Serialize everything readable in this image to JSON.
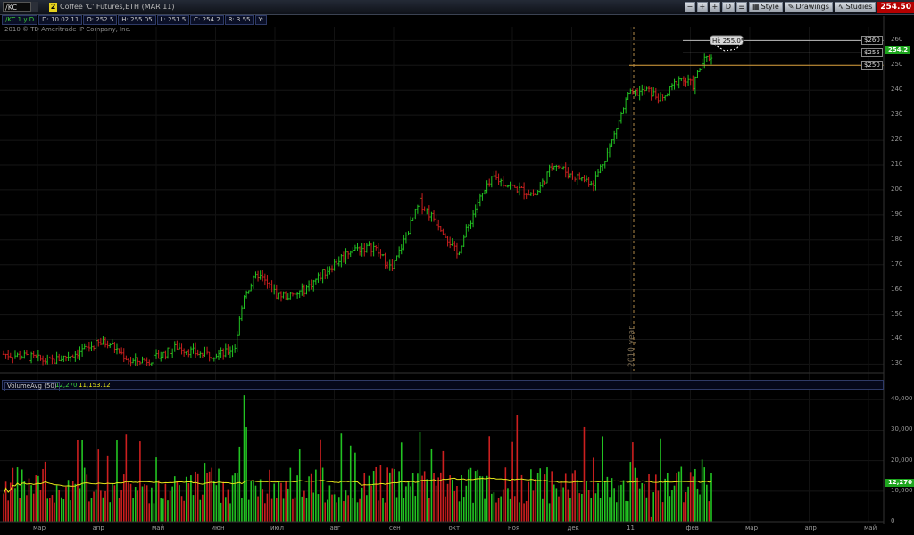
{
  "toolbar": {
    "symbol": "/KC",
    "link_number": "2",
    "description": "Coffee 'C' Futures,ETH (MAR 11)",
    "style_label": "Style",
    "drawings_label": "Drawings",
    "studies_label": "Studies",
    "d_label": "D",
    "last_price": "254.50"
  },
  "info": {
    "symbol_period": "/KC 1 y D",
    "date": "D: 10.02.11",
    "open": "O: 252.5",
    "high": "H: 255.05",
    "low": "L: 251.5",
    "close": "C: 254.2",
    "range": "R: 3.55",
    "y": "Y:"
  },
  "copyright": "2010 © TD Ameritrade IP Company, Inc.",
  "price_axis": {
    "ticks": [
      "260",
      "250",
      "240",
      "230",
      "220",
      "210",
      "200",
      "190",
      "180",
      "170",
      "160",
      "150",
      "140",
      "130"
    ],
    "current": "254.2"
  },
  "levels": [
    {
      "label": "$260",
      "value": 260
    },
    {
      "label": "$255",
      "value": 255
    },
    {
      "label": "$250",
      "value": 250
    }
  ],
  "high_callout": "Hi: 255.05",
  "year_marker": "2010 year",
  "volume": {
    "study": "VolumeAvg (50)",
    "value": "12,270",
    "avg": "11,153.12",
    "ticks": [
      "40,000",
      "30,000",
      "20,000",
      "10,000",
      "0"
    ],
    "current": "12,270"
  },
  "x_axis": {
    "months": [
      "мар",
      "апр",
      "май",
      "июн",
      "июл",
      "авг",
      "сен",
      "окт",
      "ноя",
      "дек",
      "11",
      "фев",
      "мар",
      "апр",
      "май"
    ]
  },
  "colors": {
    "up": "#22c322",
    "down": "#cc1f1f",
    "avg": "#e6e619",
    "level": "#d9a03a"
  },
  "chart_data": {
    "type": "candlestick",
    "ylim": [
      128,
      263
    ],
    "volume_ylim": [
      0,
      43000
    ],
    "anchors": [
      [
        0,
        134
      ],
      [
        10,
        133
      ],
      [
        20,
        131
      ],
      [
        30,
        134
      ],
      [
        40,
        138
      ],
      [
        45,
        139
      ],
      [
        55,
        131
      ],
      [
        65,
        132
      ],
      [
        75,
        137
      ],
      [
        85,
        134
      ],
      [
        95,
        134
      ],
      [
        100,
        137
      ],
      [
        104,
        158
      ],
      [
        110,
        166
      ],
      [
        118,
        158
      ],
      [
        125,
        157
      ],
      [
        130,
        160
      ],
      [
        140,
        168
      ],
      [
        150,
        176
      ],
      [
        160,
        177
      ],
      [
        168,
        168
      ],
      [
        175,
        184
      ],
      [
        180,
        195
      ],
      [
        190,
        184
      ],
      [
        196,
        174
      ],
      [
        205,
        195
      ],
      [
        212,
        205
      ],
      [
        220,
        201
      ],
      [
        230,
        198
      ],
      [
        238,
        211
      ],
      [
        245,
        206
      ],
      [
        255,
        203
      ],
      [
        262,
        217
      ],
      [
        270,
        238
      ],
      [
        278,
        240
      ],
      [
        285,
        236
      ],
      [
        292,
        245
      ],
      [
        298,
        242
      ],
      [
        302,
        251
      ],
      [
        306,
        254
      ]
    ]
  }
}
